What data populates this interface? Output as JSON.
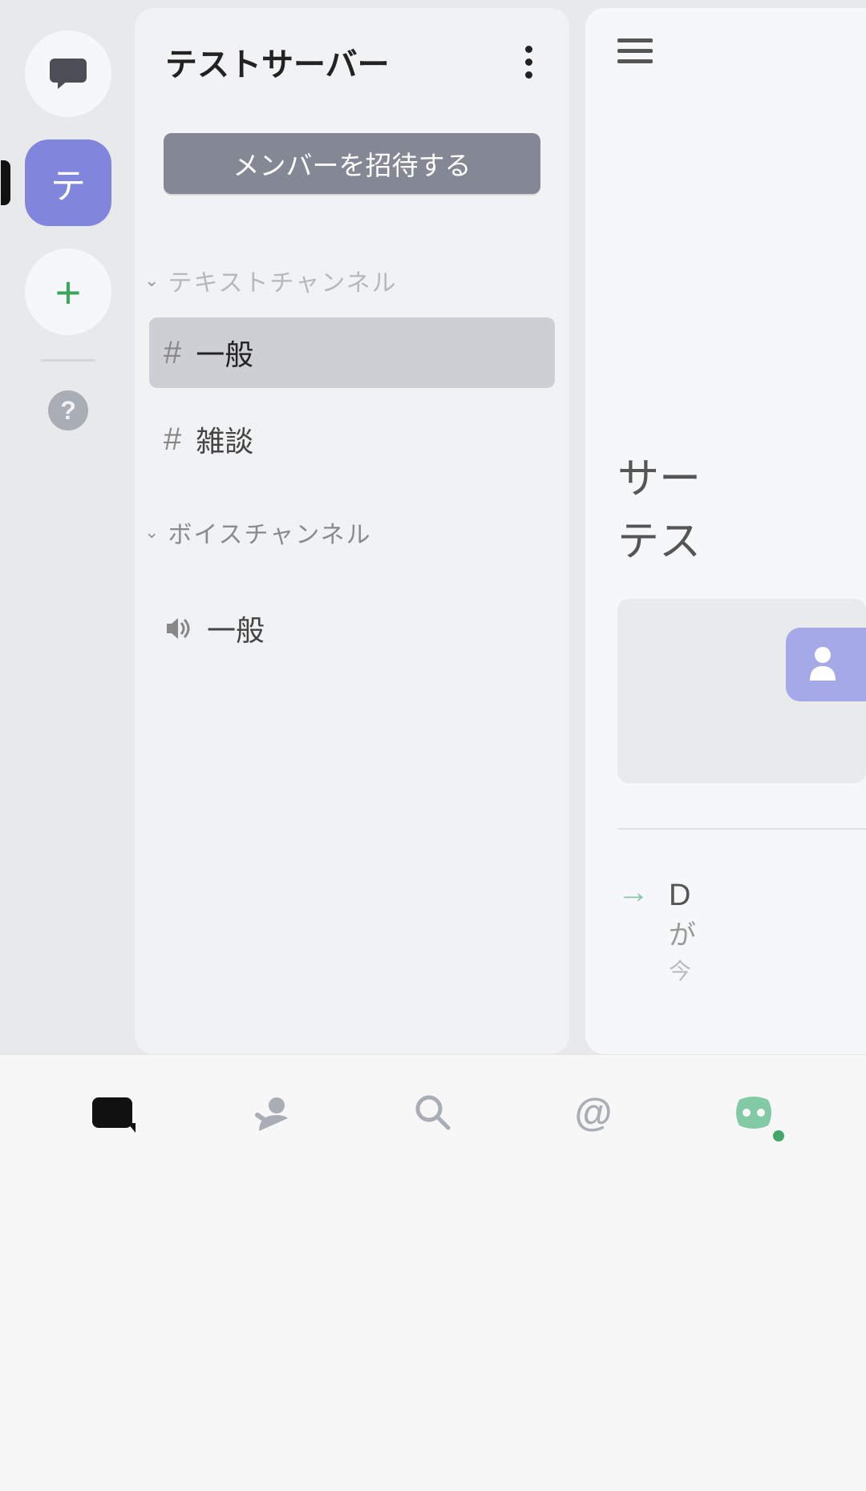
{
  "rail": {
    "server_initial": "テ"
  },
  "server": {
    "name": "テストサーバー",
    "invite_button": "メンバーを招待する"
  },
  "categories": {
    "text": "テキストチャンネル",
    "voice": "ボイスチャンネル"
  },
  "text_channels": [
    {
      "name": "一般",
      "active": true
    },
    {
      "name": "雑談",
      "active": false
    }
  ],
  "voice_channels": [
    {
      "name": "一般"
    }
  ],
  "content": {
    "title_line1": "サー",
    "title_line2": "テス",
    "arrow_char": "D",
    "arrow_sub1": "が",
    "arrow_sub2": "今"
  }
}
